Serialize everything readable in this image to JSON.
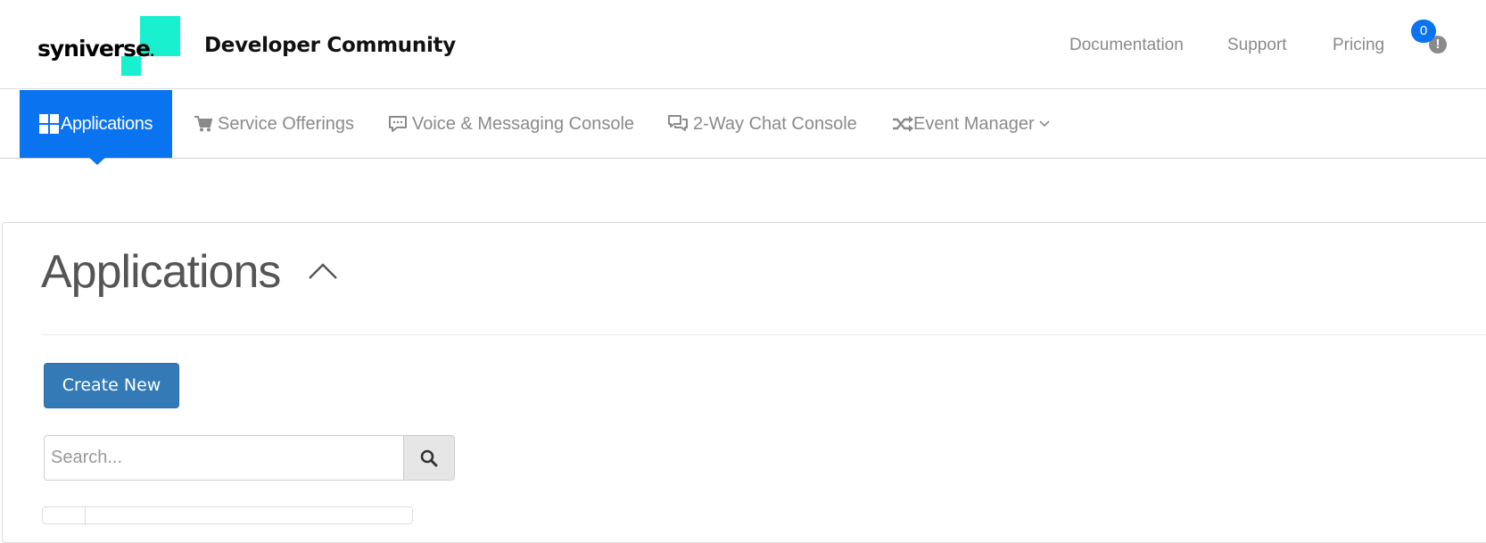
{
  "header": {
    "logo_text": "syniverse",
    "logo_dot": ".",
    "site_title": "Developer Community",
    "nav": [
      {
        "label": "Documentation"
      },
      {
        "label": "Support"
      },
      {
        "label": "Pricing"
      }
    ],
    "notification_count": "0",
    "notification_icon": "exclamation-circle-icon"
  },
  "subnav": {
    "items": [
      {
        "label": "Applications",
        "icon": "grid-icon",
        "active": true
      },
      {
        "label": "Service Offerings",
        "icon": "cart-icon"
      },
      {
        "label": "Voice & Messaging Console",
        "icon": "comment-icon"
      },
      {
        "label": "2-Way Chat Console",
        "icon": "comments-icon"
      },
      {
        "label": "Event Manager",
        "icon": "shuffle-icon",
        "dropdown": true
      }
    ]
  },
  "main": {
    "title": "Applications",
    "create_label": "Create New",
    "search_placeholder": "Search..."
  },
  "colors": {
    "accent": "#0a73f0",
    "button": "#337ab7",
    "logo": "#19f0cf",
    "muted_text": "#8a8a8a"
  }
}
